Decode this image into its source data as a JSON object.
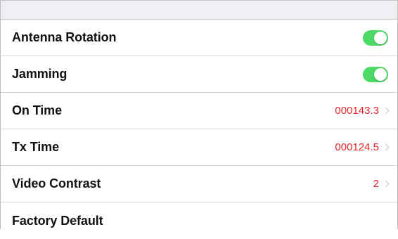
{
  "settings": {
    "items": [
      {
        "label": "Antenna Rotation",
        "type": "toggle",
        "on": true
      },
      {
        "label": "Jamming",
        "type": "toggle",
        "on": true
      },
      {
        "label": "On Time",
        "type": "value",
        "value": "000143.3"
      },
      {
        "label": "Tx Time",
        "type": "value",
        "value": "000124.5"
      },
      {
        "label": "Video Contrast",
        "type": "value",
        "value": "2"
      },
      {
        "label": "Factory Default",
        "type": "action"
      }
    ]
  },
  "colors": {
    "toggle_on": "#4cd964",
    "value_text": "#e8262b",
    "header_band": "#efeff4"
  }
}
